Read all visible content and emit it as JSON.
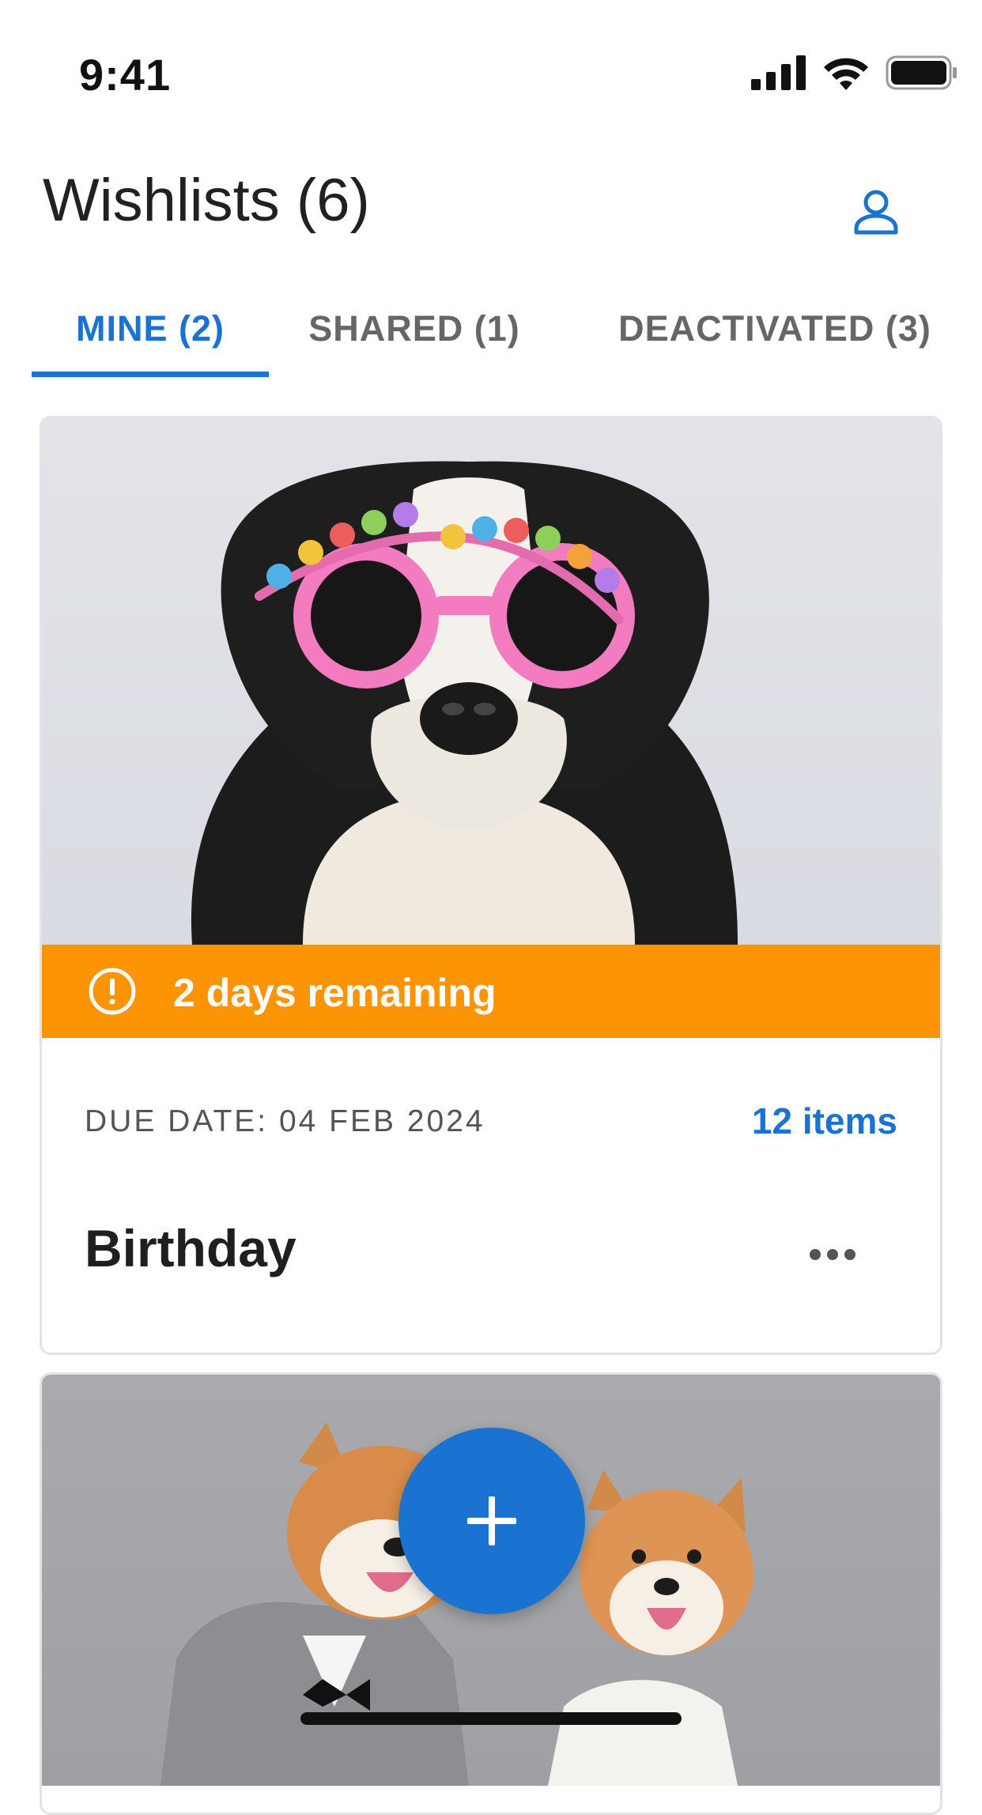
{
  "status_bar": {
    "time": "9:41"
  },
  "header": {
    "title": "Wishlists (6)",
    "profile_icon": "person-icon"
  },
  "tabs": [
    {
      "label": "MINE (2)",
      "active": true
    },
    {
      "label": "SHARED (1)",
      "active": false
    },
    {
      "label": "DEACTIVATED (3)",
      "active": false
    }
  ],
  "cards": [
    {
      "image": "dog with happy birthday glasses",
      "banner": {
        "text": "2 days remaining",
        "icon": "alert-circle-icon",
        "color": "#fc9403"
      },
      "due_date": "DUE DATE: 04 FEB 2024",
      "items_count": "12 items",
      "name": "Birthday",
      "menu_icon": "more-horizontal-icon"
    },
    {
      "image": "two shiba inu dogs in wedding outfits"
    }
  ],
  "fab": {
    "icon": "plus-icon"
  },
  "colors": {
    "accent": "#1a73d1",
    "warning": "#fc9403"
  }
}
